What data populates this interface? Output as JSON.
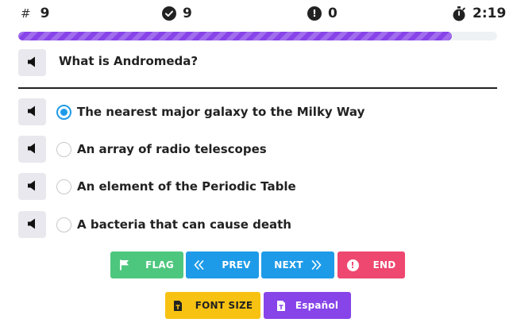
{
  "stats": {
    "question_symbol": "#",
    "question_number": "9",
    "correct_count": "9",
    "wrong_count": "0",
    "time_remaining": "2:19"
  },
  "progress": {
    "fraction": 0.905,
    "color": "#8744e8"
  },
  "question": {
    "text": "What is Andromeda?"
  },
  "options": [
    {
      "label": "The nearest major galaxy to the Milky Way",
      "selected": true
    },
    {
      "label": "An array of radio telescopes",
      "selected": false
    },
    {
      "label": "An element of the Periodic Table",
      "selected": false
    },
    {
      "label": "A bacteria that can cause death",
      "selected": false
    }
  ],
  "buttons": {
    "flag": "FLAG",
    "prev": "PREV",
    "next": "NEXT",
    "end": "END",
    "font_size": "FONT SIZE",
    "language": "Español"
  },
  "colors": {
    "accent_blue": "#1e9be8",
    "flag_green": "#4ec77e",
    "end_red": "#ee4770",
    "font_yellow": "#f8c212",
    "language_purple": "#8744e8"
  },
  "icons": {
    "question_number": "hash-icon",
    "correct": "check-circle-icon",
    "wrong": "exclamation-circle-icon",
    "timer": "stopwatch-icon",
    "audio": "speaker-icon",
    "flag": "flag-icon",
    "prev": "double-chevron-left-icon",
    "next": "double-chevron-right-icon",
    "end": "exclamation-circle-icon",
    "font_size": "font-size-icon",
    "language": "translate-icon"
  }
}
